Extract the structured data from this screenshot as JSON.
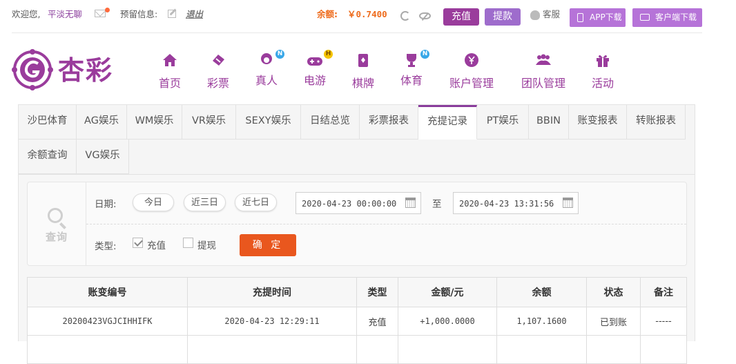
{
  "topbar": {
    "welcome": "欢迎您,",
    "username": "平淡无聊",
    "reserved_info": "预留信息:",
    "logout": "退出",
    "balance_label": "余额:",
    "balance_value": "￥0.7400",
    "deposit": "充值",
    "withdraw": "提款",
    "service": "客服",
    "app_download": "APP下载",
    "client_download": "客户端下载",
    "brand_color": "#9a3c9c",
    "accent_color": "#ee6b1c"
  },
  "logo": {
    "text": "杏彩"
  },
  "nav": [
    {
      "label": "首页",
      "icon": "home-icon"
    },
    {
      "label": "彩票",
      "icon": "ticket-icon"
    },
    {
      "label": "真人",
      "icon": "dealer-icon",
      "badge": "N"
    },
    {
      "label": "电游",
      "icon": "gamepad-icon",
      "badge": "H"
    },
    {
      "label": "棋牌",
      "icon": "cards-icon"
    },
    {
      "label": "体育",
      "icon": "trophy-icon",
      "badge": "N"
    },
    {
      "label": "账户管理",
      "icon": "yen-icon"
    },
    {
      "label": "团队管理",
      "icon": "team-icon"
    },
    {
      "label": "活动",
      "icon": "gift-icon"
    }
  ],
  "tabs": [
    "沙巴体育",
    "AG娱乐",
    "WM娱乐",
    "VR娱乐",
    "SEXY娱乐",
    "日结总览",
    "彩票报表",
    "充提记录",
    "PT娱乐",
    "BBIN",
    "账变报表",
    "转账报表",
    "余额查询",
    "VG娱乐"
  ],
  "active_tab": "充提记录",
  "filter": {
    "query_label": "查询",
    "date_label": "日期:",
    "quick_ranges": [
      "今日",
      "近三日",
      "近七日"
    ],
    "start": "2020-04-23 00:00:00",
    "to": "至",
    "end": "2020-04-23 13:31:56",
    "type_label": "类型:",
    "types": [
      {
        "label": "充值",
        "checked": true
      },
      {
        "label": "提现",
        "checked": false
      }
    ],
    "confirm": "确 定"
  },
  "table": {
    "headers": [
      "账变编号",
      "充提时间",
      "类型",
      "金额/元",
      "余额",
      "状态",
      "备注"
    ],
    "rows": [
      [
        "20200423VGJCIHHIFK",
        "2020-04-23 12:29:11",
        "充值",
        "+1,000.0000",
        "1,107.1600",
        "已到账",
        "-----"
      ]
    ]
  }
}
